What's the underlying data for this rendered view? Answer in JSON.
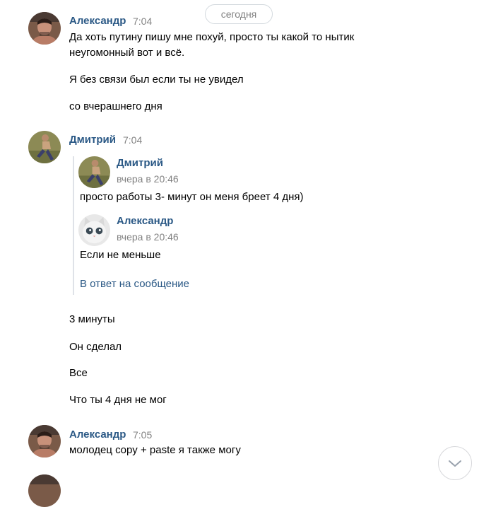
{
  "date_separator": "сегодня",
  "messages": [
    {
      "author": "Александр",
      "time": "7:04",
      "avatar_icon": "user-avatar-man-icon",
      "lines": [
        "Да хоть путину пишу мне похуй, просто ты какой то нытик",
        "неугомонный вот и всё.",
        "Я без связи был если ты не увидел",
        "со вчерашнего дня"
      ]
    },
    {
      "author": "Дмитрий",
      "time": "7:04",
      "avatar_icon": "user-avatar-running-icon",
      "forwarded": [
        {
          "author": "Дмитрий",
          "time": "вчера в 20:46",
          "avatar_icon": "user-avatar-running-icon",
          "text": "просто работы 3- минут он меня бреет 4 дня)"
        },
        {
          "author": "Александр",
          "time": "вчера в 20:46",
          "avatar_icon": "user-avatar-cat-icon",
          "text": "Если не меньше"
        }
      ],
      "reply_link": "В ответ на сообщение",
      "lines": [
        "3 минуты",
        "Он сделал",
        "Все",
        "Что ты 4 дня не мог"
      ]
    },
    {
      "author": "Александр",
      "time": "7:05",
      "avatar_icon": "user-avatar-man-icon",
      "lines": [
        "молодец copy + paste я также могу"
      ]
    }
  ],
  "scroll_down_icon": "chevron-down-icon",
  "colors": {
    "author": "#2a5885",
    "link": "#2a5885",
    "time": "#828282",
    "text": "#000000",
    "quote_bar": "#dfe2e8"
  }
}
